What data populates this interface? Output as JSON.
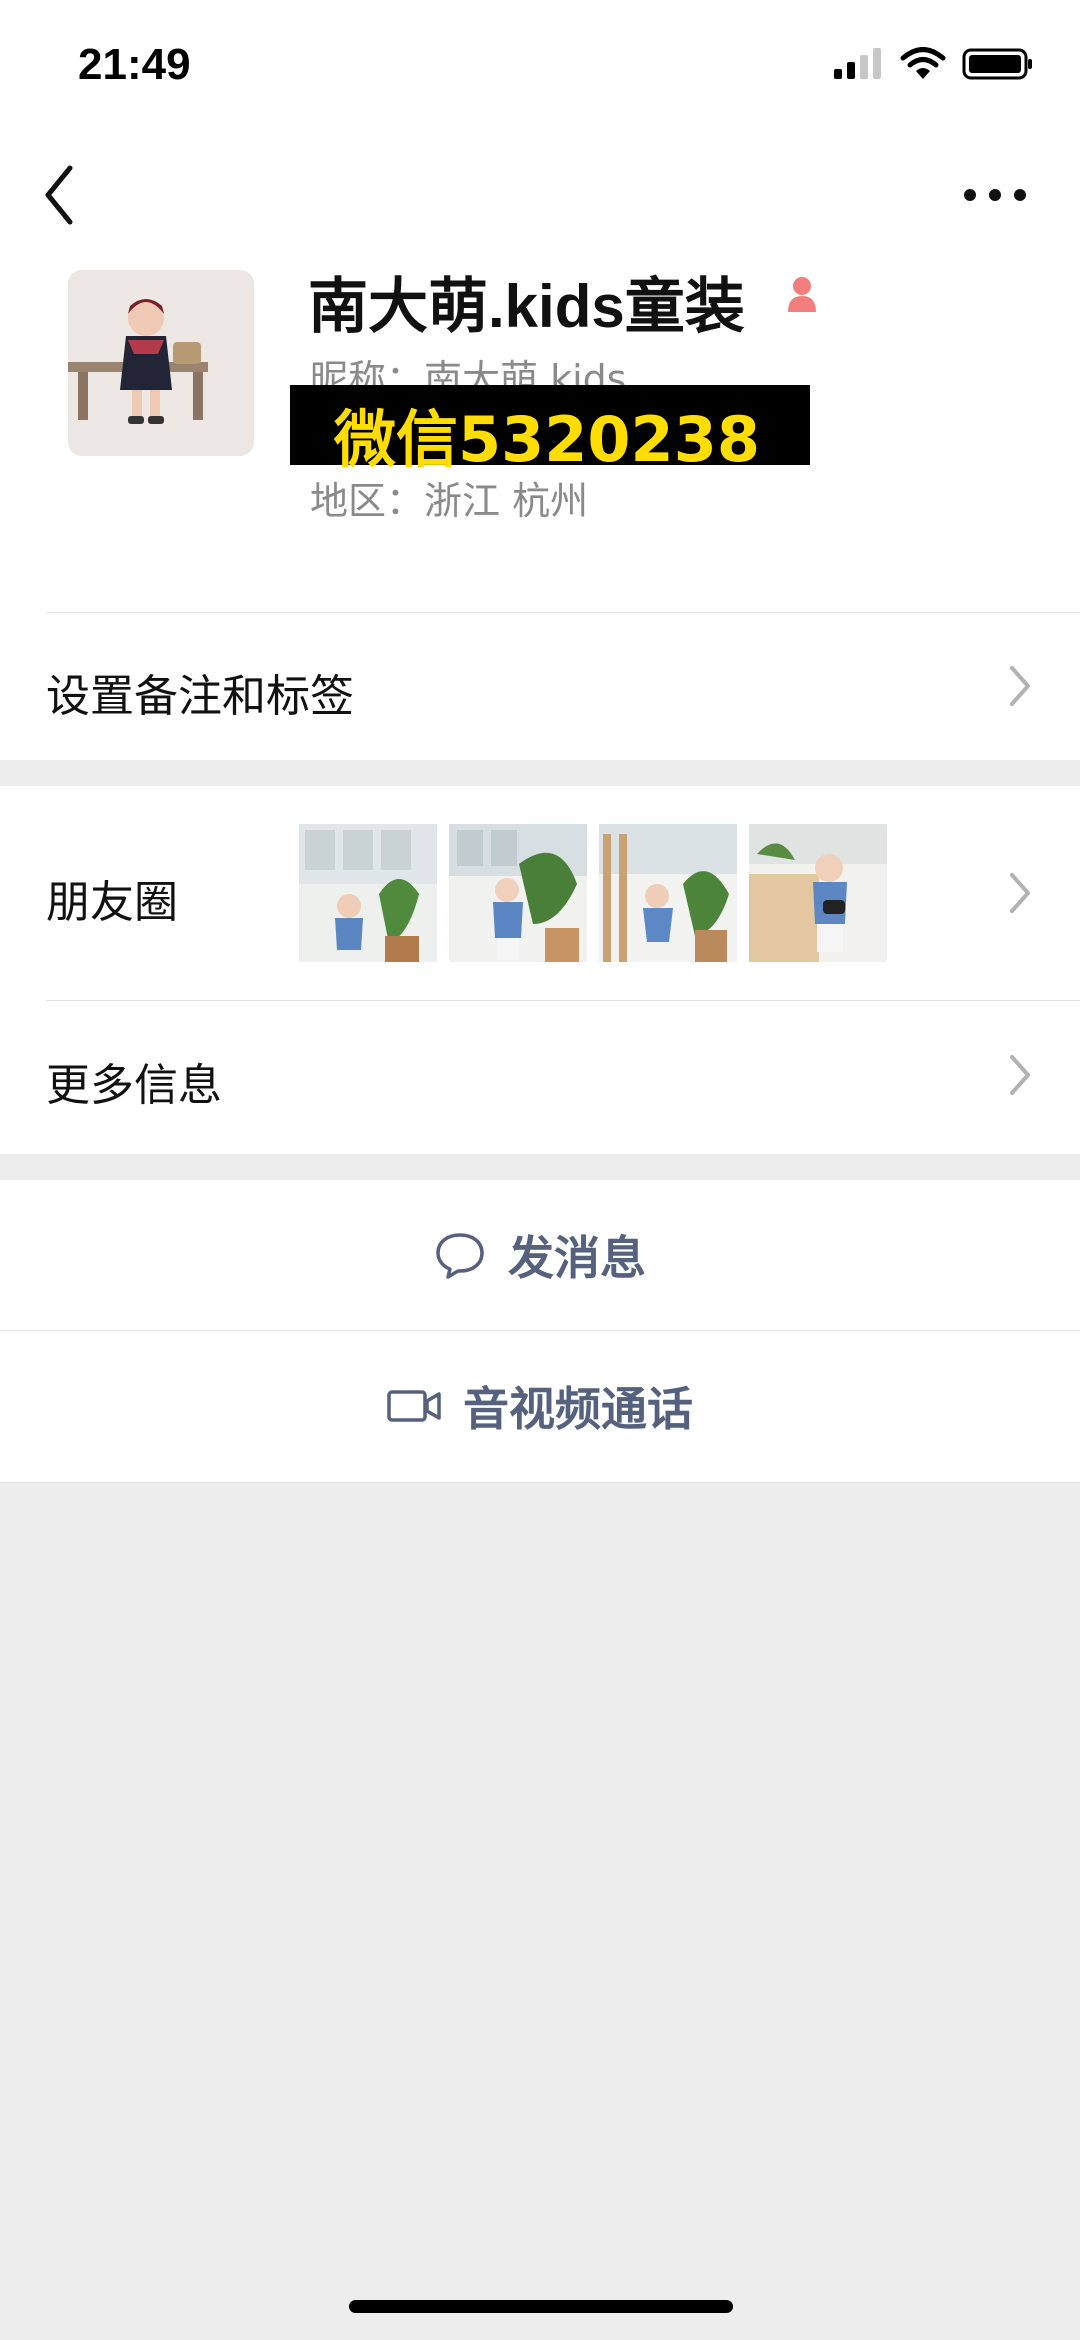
{
  "status": {
    "time": "21:49"
  },
  "profile": {
    "name": "南大萌.kids童装",
    "nickname": "昵称：南大萌.kids",
    "region": "地区：浙江 杭州",
    "watermark": "微信5320238"
  },
  "rows": {
    "remark_label": "设置备注和标签",
    "moments_label": "朋友圈",
    "more_info_label": "更多信息"
  },
  "actions": {
    "message_label": "发消息",
    "call_label": "音视频通话"
  },
  "icons": {
    "back": "back-chevron-icon",
    "more": "more-dots-icon",
    "gender": "female-icon",
    "message": "chat-bubble-icon",
    "call": "video-camera-icon"
  },
  "colors": {
    "accent": "#56617e",
    "gender": "#f37e7e",
    "watermark_text": "#ffdd00"
  }
}
